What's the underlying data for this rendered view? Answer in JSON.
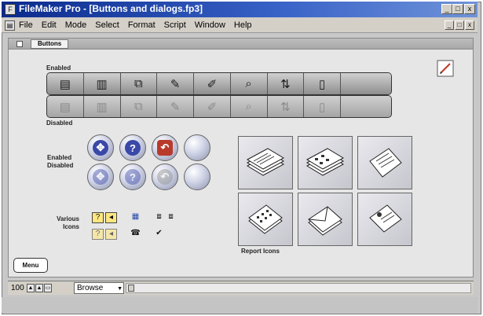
{
  "window": {
    "title": "FileMaker Pro - [Buttons and dialogs.fp3]",
    "controls": {
      "minimize": "_",
      "maximize": "□",
      "close": "x"
    }
  },
  "menubar": {
    "items": [
      "File",
      "Edit",
      "Mode",
      "Select",
      "Format",
      "Script",
      "Window",
      "Help"
    ],
    "mdi_controls": [
      "_",
      "□",
      "x"
    ]
  },
  "layout": {
    "tab_label": "Buttons"
  },
  "toolbar": {
    "enabled_label": "Enabled",
    "disabled_label": "Disabled",
    "icons": [
      "list-view-icon",
      "columns-view-icon",
      "copy-records-icon",
      "delete-records-icon",
      "export-records-icon",
      "find-records-icon",
      "sort-records-icon",
      "report-doc-icon",
      "blank"
    ]
  },
  "circle_buttons": {
    "label_enabled": "Enabled",
    "label_disabled": "Disabled",
    "items": [
      {
        "name": "navigate-icon",
        "glyph": "✥"
      },
      {
        "name": "help-icon",
        "glyph": "?"
      },
      {
        "name": "undo-icon",
        "glyph": "↶"
      },
      {
        "name": "blank-circle",
        "glyph": ""
      }
    ]
  },
  "various_icons": {
    "label": "Various Icons"
  },
  "report_icons": {
    "label": "Report Icons"
  },
  "menu_button": {
    "label": "Menu"
  },
  "statusbar": {
    "zoom": "100",
    "mode": "Browse"
  }
}
